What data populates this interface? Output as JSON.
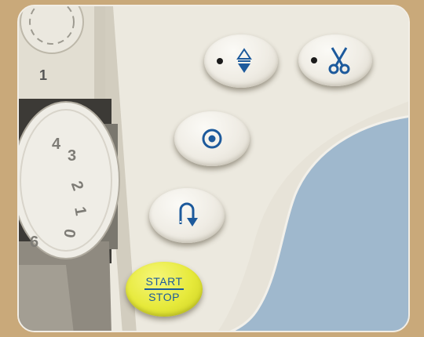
{
  "panel": {
    "start_stop_top": "START",
    "start_stop_bottom": "STOP",
    "buttons": [
      {
        "name": "needle-position-button",
        "icon": "needle-up-down-icon"
      },
      {
        "name": "thread-cutter-button",
        "icon": "scissors-icon"
      },
      {
        "name": "auto-lock-button",
        "icon": "target-circle-icon"
      },
      {
        "name": "reverse-stitch-button",
        "icon": "reverse-arrow-icon"
      }
    ]
  },
  "dial": {
    "marks": [
      "1",
      "4",
      "3",
      "2",
      "1",
      "0",
      "6"
    ]
  },
  "colors": {
    "accent_blue": "#1d5a9c",
    "start_yellow": "#e6e93a",
    "body_blue": "#9fb8cd"
  }
}
